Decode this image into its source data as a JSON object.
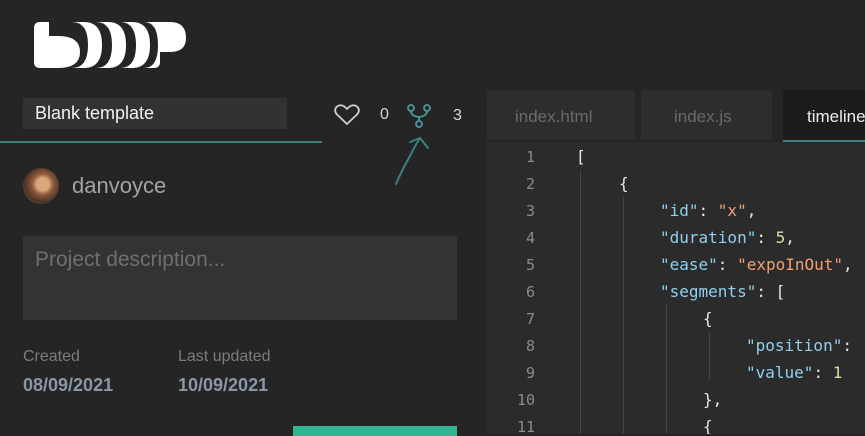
{
  "project": {
    "title_value": "Blank template",
    "likes": "0",
    "forks": "3",
    "author": "danvoyce",
    "description_placeholder": "Project description...",
    "created_label": "Created",
    "created_date": "08/09/2021",
    "updated_label": "Last updated",
    "updated_date": "10/09/2021"
  },
  "icons": {
    "logo": "app-logo",
    "heart": "heart-icon",
    "fork": "fork-icon",
    "pointer": "curved-arrow-icon"
  },
  "editor": {
    "tabs": [
      {
        "label": "index.html",
        "active": false
      },
      {
        "label": "index.js",
        "active": false
      },
      {
        "label": "timeline.json",
        "active": true
      }
    ],
    "line_numbers": [
      "1",
      "2",
      "3",
      "4",
      "5",
      "6",
      "7",
      "8",
      "9",
      "10",
      "11"
    ],
    "code": {
      "l1": "[",
      "l2": "{",
      "l3_key": "\"id\"",
      "l3_sep": ": ",
      "l3_val": "\"x\"",
      "l3_end": ",",
      "l4_key": "\"duration\"",
      "l4_sep": ": ",
      "l4_val": "5",
      "l4_end": ",",
      "l5_key": "\"ease\"",
      "l5_sep": ": ",
      "l5_val": "\"expoInOut\"",
      "l5_end": ",",
      "l6_key": "\"segments\"",
      "l6_sep": ": [",
      "l7": "{",
      "l8_key": "\"position\"",
      "l8_sep": ":",
      "l9_key": "\"value\"",
      "l9_sep": ": ",
      "l9_val": "1",
      "l10": "},",
      "l11": "{"
    }
  },
  "colors": {
    "accent_teal": "#3d7f84",
    "save_green": "#2fb591",
    "json_key": "#8fd0f0",
    "json_string": "#f0a070",
    "json_number": "#cde5a0"
  }
}
